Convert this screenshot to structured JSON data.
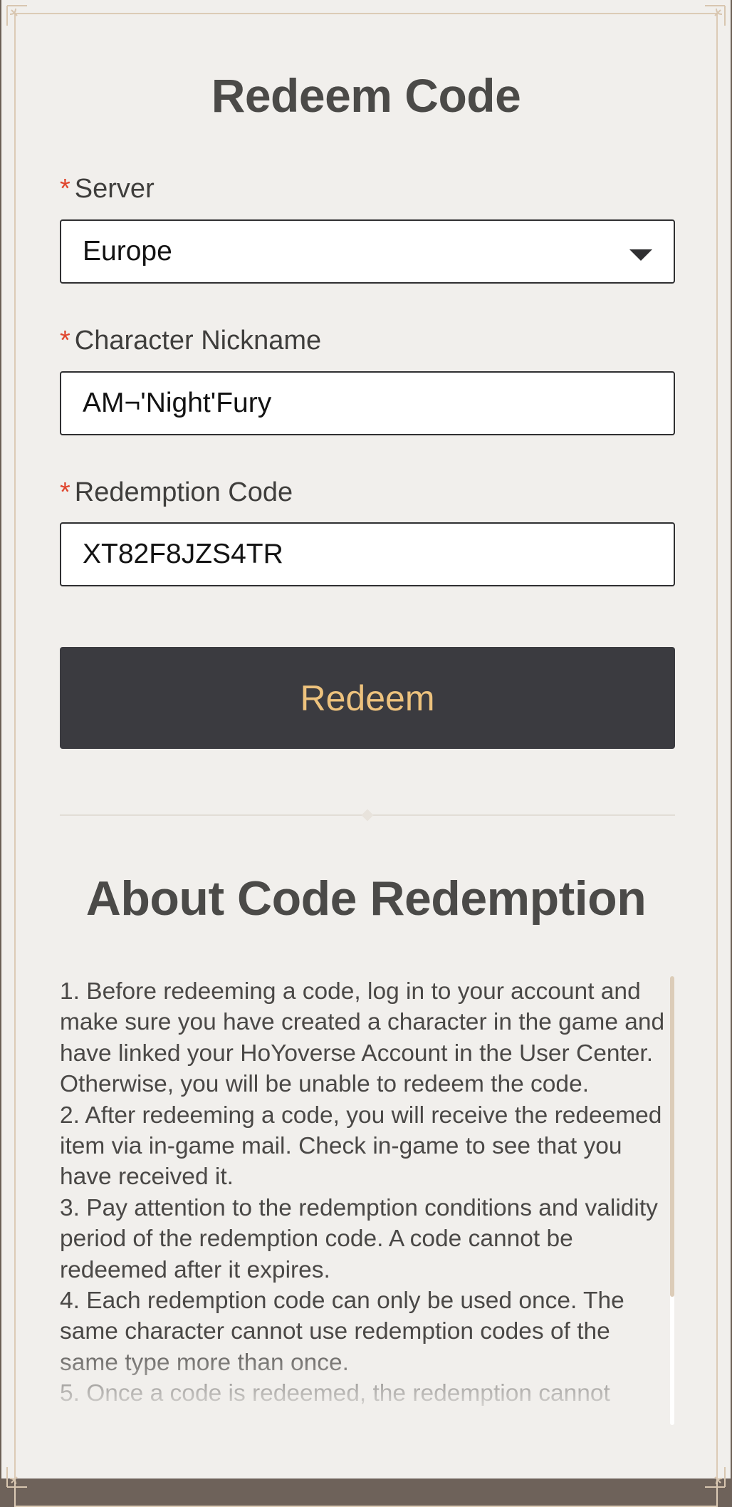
{
  "form": {
    "title": "Redeem Code",
    "required_mark": "*",
    "server": {
      "label": "Server",
      "value": "Europe"
    },
    "nickname": {
      "label": "Character Nickname",
      "value": "AM¬'Night'Fury"
    },
    "code": {
      "label": "Redemption Code",
      "value": "XT82F8JZS4TR"
    },
    "redeem_label": "Redeem"
  },
  "about": {
    "title": "About Code Redemption",
    "items": [
      "1. Before redeeming a code, log in to your account and make sure you have created a character in the game and have linked your HoYoverse Account in the User Center. Otherwise, you will be unable to redeem the code.",
      "2. After redeeming a code, you will receive the redeemed item via in-game mail. Check in-game to see that you have received it.",
      "3. Pay attention to the redemption conditions and validity period of the redemption code. A code cannot be redeemed after it expires.",
      "4. Each redemption code can only be used once. The same character cannot use redemption codes of the same type more than once.",
      "5. Once a code is redeemed, the redemption cannot"
    ]
  },
  "colors": {
    "background": "#f1efec",
    "button_bg": "#3b3b40",
    "button_text": "#edc27d",
    "required_star": "#e0452d"
  }
}
